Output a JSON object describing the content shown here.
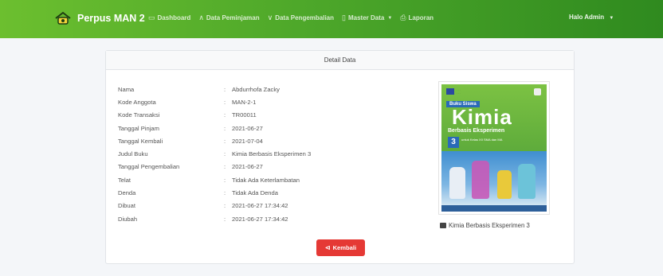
{
  "navbar": {
    "brand": "Perpus MAN 2",
    "logo_icon": "library-logo-icon",
    "items": [
      {
        "icon": "monitor-icon",
        "glyph": "▭",
        "label": "Dashboard"
      },
      {
        "icon": "chevron-up-icon",
        "glyph": "∧",
        "label": "Data Peminjaman"
      },
      {
        "icon": "chevron-down-icon",
        "glyph": "∨",
        "label": "Data Pengembalian"
      },
      {
        "icon": "folder-icon",
        "glyph": "▯",
        "label": "Master Data",
        "has_dropdown": true
      },
      {
        "icon": "printer-icon",
        "glyph": "⎙",
        "label": "Laporan"
      }
    ],
    "user": "Halo Admin",
    "user_caret": "▼",
    "accent": "#4ea82a"
  },
  "card": {
    "title": "Detail Data",
    "separator": ":",
    "fields": [
      {
        "label": "Nama",
        "value": "Abdurrhofa Zacky"
      },
      {
        "label": "Kode Anggota",
        "value": "MAN-2-1"
      },
      {
        "label": "Kode Transaksi",
        "value": "TR00011"
      },
      {
        "label": "Tanggal Pinjam",
        "value": "2021-06-27"
      },
      {
        "label": "Tanggal Kembali",
        "value": "2021-07-04"
      },
      {
        "label": "Judul Buku",
        "value": "Kimia Berbasis Eksperimen 3"
      },
      {
        "label": "Tanggal Pengembalian",
        "value": "2021-06-27"
      },
      {
        "label": "Telat",
        "value": "Tidak Ada Keterlambatan"
      },
      {
        "label": "Denda",
        "value": "Tidak Ada Denda"
      },
      {
        "label": "Dibuat",
        "value": "2021-06-27 17:34:42"
      },
      {
        "label": "Diubah",
        "value": "2021-06-27 17:34:42"
      }
    ],
    "book": {
      "cover_badge": "Buku Siswa",
      "cover_title": "Kimia",
      "cover_subtitle": "Berbasis Eksperimen",
      "cover_number": "3",
      "cover_class": "untuk Kelas XII SMA dan MA",
      "caption": "Kimia Berbasis Eksperimen 3",
      "caption_icon": "image-icon"
    },
    "back_button": {
      "label": "Kembali",
      "icon": "back-arrow-icon",
      "glyph": "⊲",
      "color": "#e53935"
    }
  }
}
